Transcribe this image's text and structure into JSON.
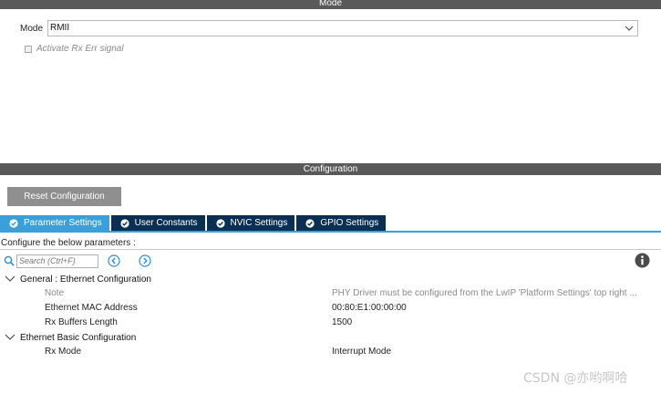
{
  "mode_section": {
    "header": "Mode",
    "mode_label": "Mode",
    "mode_value": "RMII",
    "rx_err_label": "Activate Rx Err signal",
    "rx_err_checked": false
  },
  "config_section": {
    "header": "Configuration",
    "reset_button": "Reset Configuration",
    "tabs": [
      {
        "label": "Parameter Settings",
        "active": true
      },
      {
        "label": "User Constants",
        "active": false
      },
      {
        "label": "NVIC Settings",
        "active": false
      },
      {
        "label": "GPIO Settings",
        "active": false
      }
    ],
    "configure_text": "Configure the below parameters :",
    "search_placeholder": "Search (Ctrl+F)",
    "groups": [
      {
        "title": "General : Ethernet Configuration",
        "params": [
          {
            "name": "Note",
            "value": "PHY Driver must be configured from the LwIP 'Platform Settings' top right ..."
          },
          {
            "name": "Ethernet MAC Address",
            "value": "00:80:E1:00:00:00"
          },
          {
            "name": "Rx Buffers Length",
            "value": "1500"
          }
        ]
      },
      {
        "title": "Ethernet Basic Configuration",
        "params": [
          {
            "name": "Rx Mode",
            "value": "Interrupt Mode"
          }
        ]
      }
    ]
  },
  "watermark": "CSDN @亦哟啊哈",
  "colors": {
    "header_bg": "#595959",
    "tab_active": "#3aa0dc",
    "tab_inactive": "#0b2f52",
    "reset_button_bg": "#8f8f8f",
    "nav_arrow": "#2b8fd6"
  },
  "icons": {
    "dropdown": "chevron-down-icon",
    "tab_status": "check-circle-icon",
    "search": "search-icon",
    "previous": "arrow-left-circle-icon",
    "next": "arrow-right-circle-icon",
    "info": "info-icon",
    "group_toggle": "chevron-down-icon"
  }
}
